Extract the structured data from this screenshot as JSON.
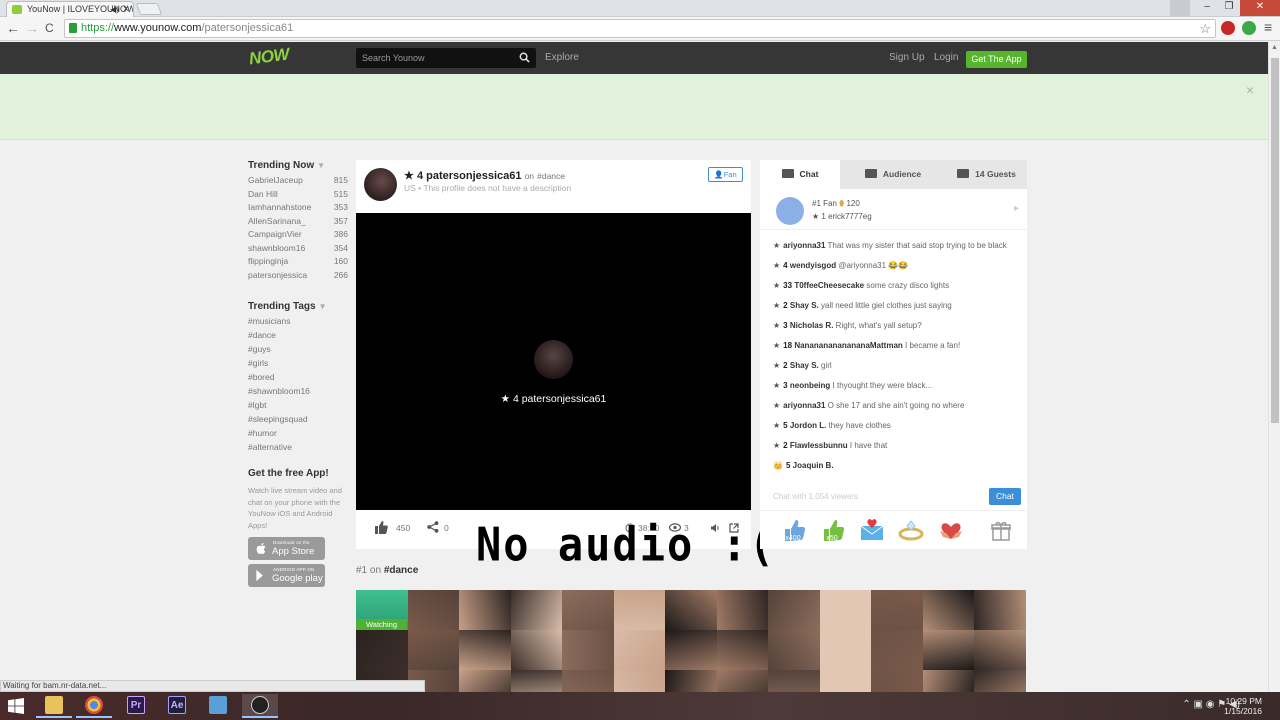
{
  "browser": {
    "tab_title": "YouNow | ILOVEYOUNOW",
    "tab_close": "×",
    "tab_mute": "◀)",
    "url_https": "https://",
    "url_host": "www.younow.com",
    "url_path": "/patersonjessica61",
    "status_text": "Waiting for bam.nr-data.net...",
    "win_min": "–",
    "win_max": "❐",
    "win_close": "✕",
    "back": "←",
    "forward": "→",
    "reload": "C",
    "bookmark_star": "☆",
    "menu": "≡"
  },
  "header": {
    "logo": "NOW",
    "search_placeholder": "Search Younow",
    "explore": "Explore",
    "signup": "Sign Up",
    "login": "Login",
    "get_app": "Get The App",
    "banner_close": "×"
  },
  "sidebar": {
    "trending_now_title": "Trending Now",
    "caret": "▼",
    "trending_now": [
      {
        "name": "GabrielJaceup",
        "count": "815"
      },
      {
        "name": "Dan Hill",
        "count": "515"
      },
      {
        "name": "Iamhannahstone",
        "count": "353"
      },
      {
        "name": "AllenSarinana_",
        "count": "357"
      },
      {
        "name": "CampaignVier",
        "count": "386"
      },
      {
        "name": "shawnbloom16",
        "count": "354"
      },
      {
        "name": "flippinginja",
        "count": "160"
      },
      {
        "name": "patersonjessica",
        "count": "266"
      }
    ],
    "trending_tags_title": "Trending Tags",
    "trending_tags": [
      "#musicians",
      "#dance",
      "#guys",
      "#girls",
      "#bored",
      "#shawnbloom16",
      "#lgbt",
      "#sleepingsquad",
      "#humor",
      "#alternative"
    ],
    "app_title": "Get the free App!",
    "app_desc": "Watch live stream video and chat on your phone with the YouNow iOS and Android Apps!",
    "app_store_small": "Download on the",
    "app_store_big": "App Store",
    "google_play_small": "ANDROID APP ON",
    "google_play_big": "Google play"
  },
  "broadcast": {
    "star": "★",
    "level": "4",
    "username": "patersonjessica61",
    "on_text": "on",
    "tag": "#dance",
    "subline": "US • This profile does not have a description",
    "fan_button": "Fan",
    "overlay_name": "★ 4 patersonjessica61",
    "likes": "450",
    "shares": "0",
    "duration": "38:40",
    "viewers_partial": "3",
    "overlay_caption": "No audio :("
  },
  "chat": {
    "tabs": [
      {
        "label": "Chat"
      },
      {
        "label": "Audience"
      },
      {
        "label": "14 Guests"
      }
    ],
    "top_fan_rank": "#1",
    "top_fan_label": "Fan",
    "top_fan_coins": "120",
    "top_fan_user": "★  1 erick7777eg",
    "messages": [
      {
        "level": "",
        "user": "ariyonna31",
        "text": "That was my sister that said stop trying to be black"
      },
      {
        "level": "4",
        "user": "wendyisgod",
        "text": "@ariyonna31 😂😂"
      },
      {
        "level": "33",
        "user": "T0ffeeCheesecake",
        "text": "some crazy disco lights"
      },
      {
        "level": "2",
        "user": "Shay S.",
        "text": "yall need little giel clothes just saying"
      },
      {
        "level": "3",
        "user": "Nicholas R.",
        "text": "Right, what's yall setup?"
      },
      {
        "level": "18",
        "user": "NanananananananaMattman",
        "text": "I became a fan!"
      },
      {
        "level": "2",
        "user": "Shay S.",
        "text": "girl"
      },
      {
        "level": "3",
        "user": "neonbeing",
        "text": "I thyought they were black..."
      },
      {
        "level": "",
        "user": "ariyonna31",
        "text": "O she 17 and she ain't going no where"
      },
      {
        "level": "5",
        "user": "Jordon L.",
        "text": "they have clothes"
      },
      {
        "level": "2",
        "user": "Flawlessbunnu",
        "text": "I have that"
      },
      {
        "level": "5",
        "user": "Joaquin B.",
        "text": ""
      }
    ],
    "input_placeholder": "Chat with 1,054 viewers",
    "send_button": "Chat",
    "gift_like_count": "x400",
    "gift_thumb_count": "x50"
  },
  "ranking": {
    "prefix": "#1 on",
    "tag": "#dance",
    "watching_label": "Watching"
  },
  "taskbar": {
    "time": "10:29 PM",
    "date": "1/15/2016",
    "premiere_label": "Pr",
    "after_effects_label": "Ae"
  }
}
